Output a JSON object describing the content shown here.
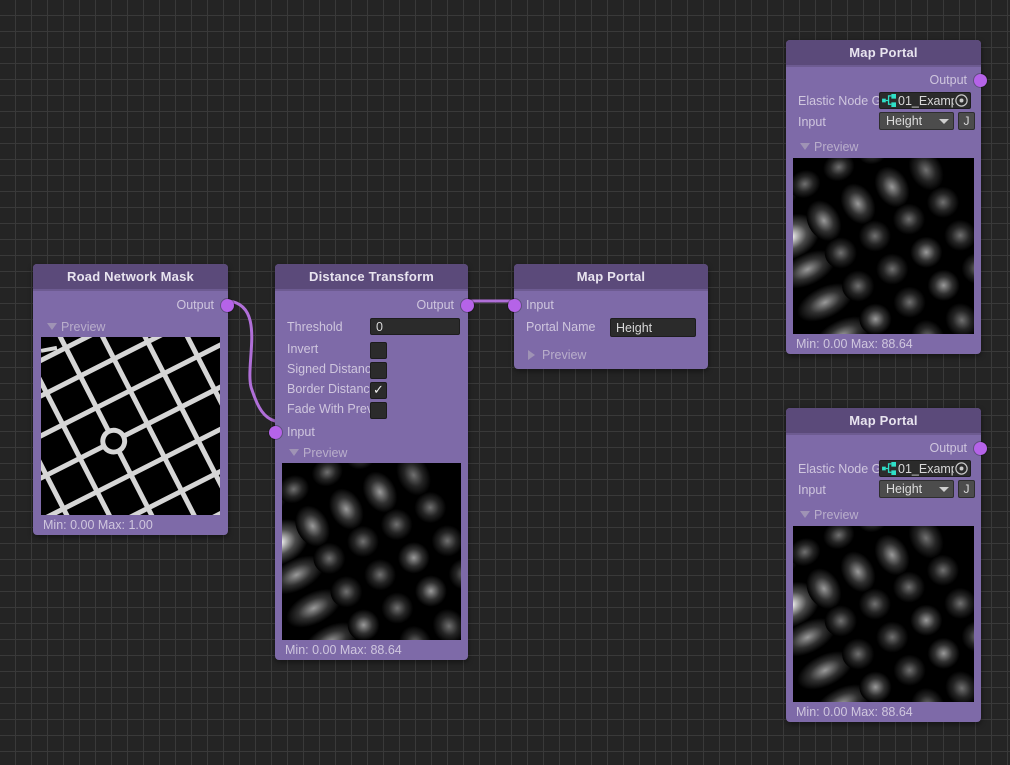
{
  "canvas": {
    "background_color": "#242424",
    "grid_minor_color": "#393939",
    "grid_major_color": "#4a4a4a"
  },
  "theme": {
    "node_header_color": "#5b4a7a",
    "node_body_color": "#7e6aa8",
    "port_color": "#b563e8",
    "wire_color": "#b06fd8",
    "field_color": "#2b2b2b",
    "label_color": "#cfc6de",
    "object_icon_color": "#2fe0c8"
  },
  "nodes": [
    {
      "id": "road-network-mask",
      "title": "Road Network Mask",
      "output_label": "Output",
      "preview": {
        "label": "Preview",
        "expanded": true,
        "art": "road-mask",
        "minmax": "Min: 0.00 Max: 1.00"
      }
    },
    {
      "id": "distance-transform",
      "title": "Distance Transform",
      "output_label": "Output",
      "input_label": "Input",
      "params": [
        {
          "label": "Threshold",
          "type": "text",
          "value": "0"
        },
        {
          "label": "Invert",
          "type": "checkbox",
          "checked": false
        },
        {
          "label": "Signed Distance",
          "type": "checkbox",
          "checked": false
        },
        {
          "label": "Border Distance",
          "type": "checkbox",
          "checked": true
        },
        {
          "label": "Fade With Previous",
          "type": "checkbox",
          "checked": false
        }
      ],
      "preview": {
        "label": "Preview",
        "expanded": true,
        "art": "distance-transform",
        "minmax": "Min: 0.00 Max: 88.64"
      }
    },
    {
      "id": "map-portal-center",
      "title": "Map Portal",
      "input_label": "Input",
      "params": [
        {
          "label": "Portal Name",
          "type": "text",
          "value": "Height"
        }
      ],
      "preview": {
        "label": "Preview",
        "expanded": false
      }
    },
    {
      "id": "map-portal-top-right",
      "title": "Map Portal",
      "output_label": "Output",
      "params": [
        {
          "label": "Elastic Node Graph",
          "type": "object",
          "value": "01_Examp",
          "icon": "node-graph-icon",
          "picker": "object-picker-icon"
        },
        {
          "label": "Input",
          "type": "dropdown",
          "value": "Height",
          "button": "J"
        }
      ],
      "preview": {
        "label": "Preview",
        "expanded": true,
        "art": "distance-transform",
        "minmax": "Min: 0.00 Max: 88.64"
      }
    },
    {
      "id": "map-portal-bottom-right",
      "title": "Map Portal",
      "output_label": "Output",
      "params": [
        {
          "label": "Elastic Node Graph",
          "type": "object",
          "value": "01_Examp",
          "icon": "node-graph-icon",
          "picker": "object-picker-icon"
        },
        {
          "label": "Input",
          "type": "dropdown",
          "value": "Height",
          "button": "J"
        }
      ],
      "preview": {
        "label": "Preview",
        "expanded": true,
        "art": "distance-transform",
        "minmax": "Min: 0.00 Max: 88.64"
      }
    }
  ]
}
